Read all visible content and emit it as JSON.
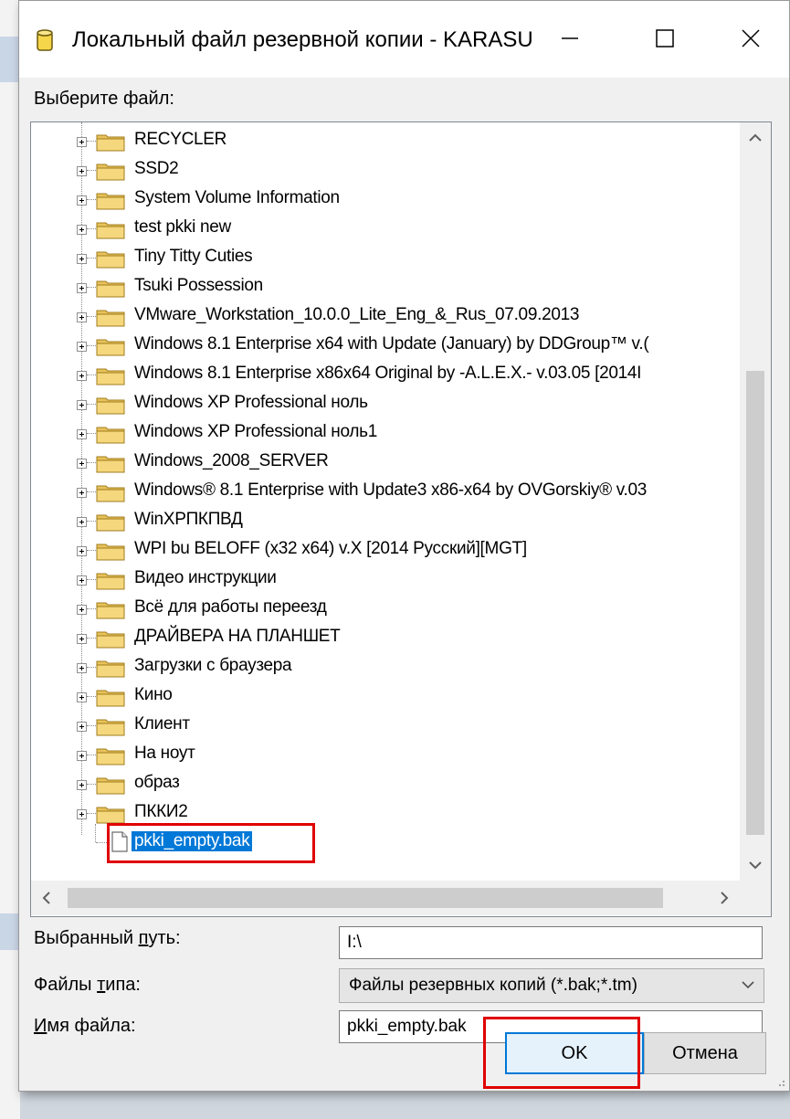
{
  "window": {
    "title": "Локальный файл резервной копии - KARASU"
  },
  "tree": {
    "label": "Выберите файл:",
    "folders": [
      "RECYCLER",
      "SSD2",
      "System Volume Information",
      "test pkki new",
      "Tiny Titty Cuties",
      "Tsuki Possession",
      "VMware_Workstation_10.0.0_Lite_Eng_&_Rus_07.09.2013",
      "Windows 8.1 Enterprise x64 with Update (January) by DDGroup™ v.(",
      "Windows 8.1 Enterprise x86x64 Original by -A.L.E.X.-  v.03.05 [2014I",
      "Windows XP Professional ноль",
      "Windows XP Professional ноль1",
      "Windows_2008_SERVER",
      "Windows® 8.1 Enterprise with Update3 x86-x64 by OVGorskiy® v.03",
      "WinXPПКПВД",
      "WPI bu BELOFF  (x32 x64) v.X [2014 Русский][MGT]",
      "Видео инструкции",
      "Всё для работы переезд",
      "ДРАЙВЕРА НА ПЛАНШЕТ",
      "Загрузки с браузера",
      "Кино",
      "Клиент",
      "На ноут",
      "образ",
      "ПККИ2"
    ],
    "selected_file": "pkki_empty.bak"
  },
  "form": {
    "path_label": "Выбранный путь:",
    "path_value": "I:\\",
    "type_label": "Файлы типа:",
    "type_value": "Файлы резервных копий (*.bak;*.tm)",
    "name_label": "Имя файла:",
    "name_value": "pkki_empty.bak"
  },
  "buttons": {
    "ok": "OK",
    "cancel": "Отмена"
  },
  "colors": {
    "selection": "#0078d7",
    "highlight_box": "#e00000"
  }
}
